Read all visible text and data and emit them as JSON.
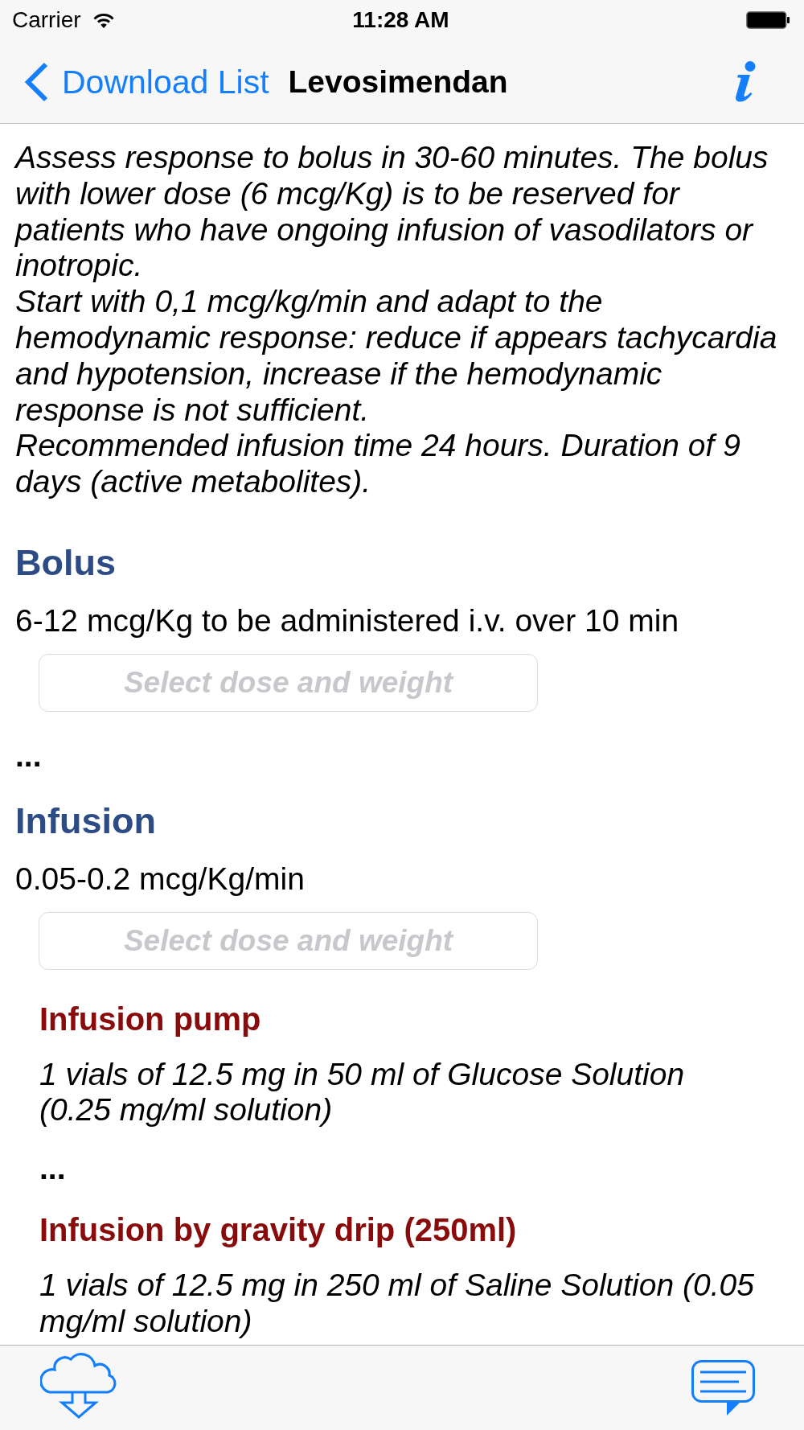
{
  "status_bar": {
    "carrier": "Carrier",
    "time": "11:28 AM"
  },
  "nav_bar": {
    "back_label": "Download List",
    "title": "Levosimendan"
  },
  "intro": [
    "Assess response to bolus in 30-60 minutes. The bolus with lower dose (6 mcg/Kg) is to be reserved for patients who have ongoing infusion of vasodilators or inotropic.",
    "Start with 0,1 mcg/kg/min and adapt to the hemodynamic response: reduce if appears tachycardia and hypotension, increase if the hemodynamic response is not sufficient.",
    "Recommended infusion time 24 hours. Duration of 9 days (active metabolites)."
  ],
  "sections": [
    {
      "title": "Bolus",
      "dose": "6-12 mcg/Kg to be administered i.v. over 10 min",
      "selector": {
        "placeholder": "Select dose and weight"
      },
      "result": "..."
    },
    {
      "title": "Infusion",
      "dose": "0.05-0.2 mcg/Kg/min",
      "selector": {
        "placeholder": "Select dose and weight"
      },
      "preparations": [
        {
          "title": "Infusion pump",
          "description": "1 vials of 12.5 mg in 50 ml of Glucose Solution (0.25 mg/ml solution)",
          "result": "..."
        },
        {
          "title": "Infusion by gravity drip (250ml)",
          "description": "1 vials of 12.5 mg in 250 ml of Saline Solution (0.05 mg/ml solution)"
        }
      ]
    }
  ]
}
